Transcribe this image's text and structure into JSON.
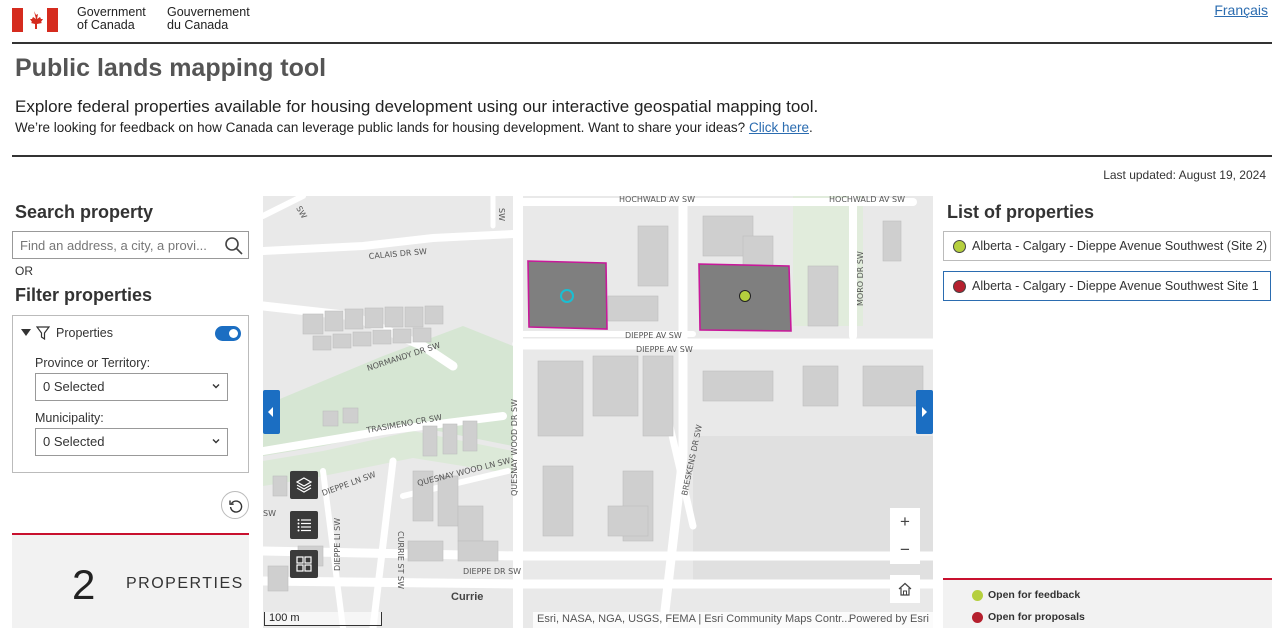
{
  "header": {
    "gov_en_line1": "Government",
    "gov_en_line2": "of Canada",
    "gov_fr_line1": "Gouvernement",
    "gov_fr_line2": "du Canada",
    "language_link": "Français",
    "flag_color": "#d52b1e"
  },
  "page": {
    "title": "Public lands mapping tool",
    "intro": "Explore federal properties available for housing development using our interactive geospatial mapping tool.",
    "feedback_text": "We’re looking for feedback on how Canada can leverage public lands for housing development. Want to share your ideas?",
    "feedback_link": "Click here",
    "feedback_end": ".",
    "last_updated": "Last updated: August 19, 2024"
  },
  "search": {
    "title": "Search property",
    "placeholder": "Find an address, a city, a provi...",
    "or_label": "OR"
  },
  "filter": {
    "title": "Filter properties",
    "layer_label": "Properties",
    "toggle_on": true,
    "province_label": "Province or Territory:",
    "province_value": "0 Selected",
    "municipality_label": "Municipality:",
    "municipality_value": "0 Selected"
  },
  "count": {
    "number": "2",
    "label": "PROPERTIES"
  },
  "map": {
    "roads": {
      "hochwald_left": "HOCHWALD AV SW",
      "hochwald_right": "HOCHWALD AV SW",
      "calais": "CALAIS DR SW",
      "normandy": "NORMANDY DR SW",
      "dieppe_av_1": "DIEPPE AV SW",
      "dieppe_av_2": "DIEPPE AV SW",
      "trasimeno": "TRASIMENO CR SW",
      "quesnay_ln": "QUESNAY WOOD LN SW",
      "quesnay_dr": "QUESNAY WOOD DR SW",
      "dieppe_ln": "DIEPPE LN SW",
      "dieppe_li": "DIEPPE LI SW",
      "currie_st": "CURRIE ST SW",
      "dieppe_dr": "DIEPPE DR SW",
      "breskens": "BRESKENS DR SW",
      "moro": "MORO DR SW",
      "sw_1": "SW",
      "sw_2": "SW",
      "sw_3": "SW"
    },
    "place": "Currie",
    "scale_label": "100 m",
    "attribution": "Esri, NASA, NGA, USGS, FEMA | Esri Community Maps Contr...",
    "powered_by": "Powered by Esri",
    "zoom_in": "+",
    "zoom_out": "−",
    "parcel_color": "#c8199a",
    "parcel_fill": "#7f7f7f"
  },
  "properties": {
    "title": "List of properties",
    "items": [
      {
        "label": "Alberta - Calgary - Dieppe Avenue Southwest (Site 2)",
        "status_color": "#b5cf3e"
      },
      {
        "label": "Alberta - Calgary - Dieppe Avenue Southwest Site 1",
        "status_color": "#b5202e"
      }
    ]
  },
  "legend": {
    "feedback_label": "Open for feedback",
    "feedback_color": "#b5cf3e",
    "proposals_label": "Open for proposals",
    "proposals_color": "#b5202e"
  }
}
